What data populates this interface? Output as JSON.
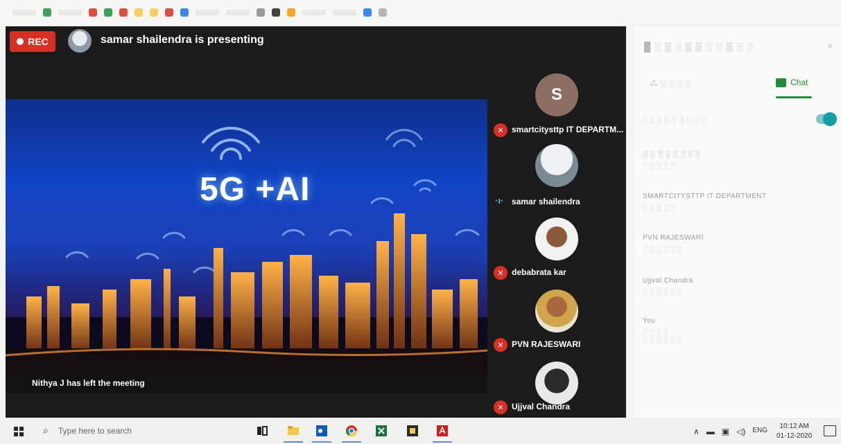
{
  "meeting": {
    "rec_label": "REC",
    "presenting_text": "samar shailendra is presenting",
    "slide_title": "5G +AI",
    "toast": "Nithya J has left the meeting"
  },
  "participants": [
    {
      "name": "smartcitysttp IT DEPARTM...",
      "initial": "S",
      "mic": "muted"
    },
    {
      "name": "samar shailendra",
      "mic": "speaking"
    },
    {
      "name": "debabrata kar",
      "mic": "muted"
    },
    {
      "name": "PVN RAJESWARI",
      "mic": "muted"
    },
    {
      "name": "Ujjval Chandra",
      "mic": "muted"
    }
  ],
  "chat_panel": {
    "chat_tab": "Chat",
    "close": "×",
    "messages": [
      {
        "sender": "SMARTCITYSTTP IT DEPARTMENT"
      },
      {
        "sender": "PVN RAJESWARI"
      },
      {
        "sender": "Ujjval Chandra"
      },
      {
        "sender": "You"
      }
    ]
  },
  "taskbar": {
    "search_placeholder": "Type here to search",
    "lang": "ENG",
    "time": "10:12 AM",
    "date": "01-12-2020"
  },
  "colors": {
    "rec_red": "#d93025",
    "chat_green": "#1e8e3e",
    "toggle_teal": "#149ea5"
  }
}
